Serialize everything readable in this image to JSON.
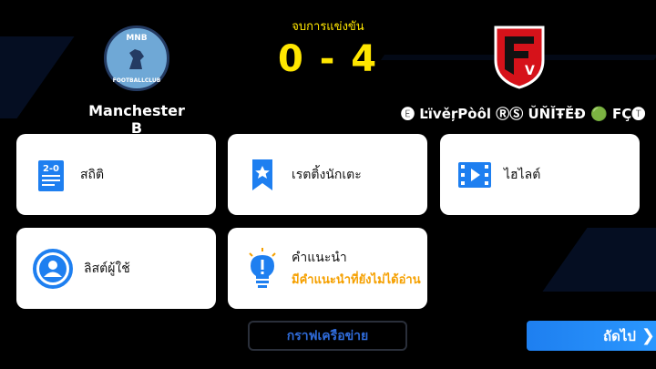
{
  "match": {
    "status": "จบการแข่งขัน",
    "score": "0 - 4",
    "home": {
      "name": "Manchester B",
      "logo_abbr": "MNB",
      "logo_club": "FOOTBALLCLUB"
    },
    "away": {
      "name": "🅔 ĿïvěŗPòôl ⓇⓈ ŬŇĬŦĔĐ 🟢 FÇ🅣"
    }
  },
  "cards": {
    "stats": "สถิติ",
    "stats_icon_text": "2-0",
    "player_rating": "เรตติ้งนักเตะ",
    "highlights": "ไฮไลต์",
    "user_list": "ลิสต์ผู้ใช้",
    "tips_title": "คำแนะนำ",
    "tips_sub": "มีคำแนะนำที่ยังไม่ได้อ่าน"
  },
  "buttons": {
    "network_graph": "กราฟเครือข่าย",
    "next": "ถัดไป"
  },
  "colors": {
    "accent_yellow": "#ffe600",
    "accent_blue": "#1e7ff0",
    "tip_orange": "#f5a000"
  }
}
